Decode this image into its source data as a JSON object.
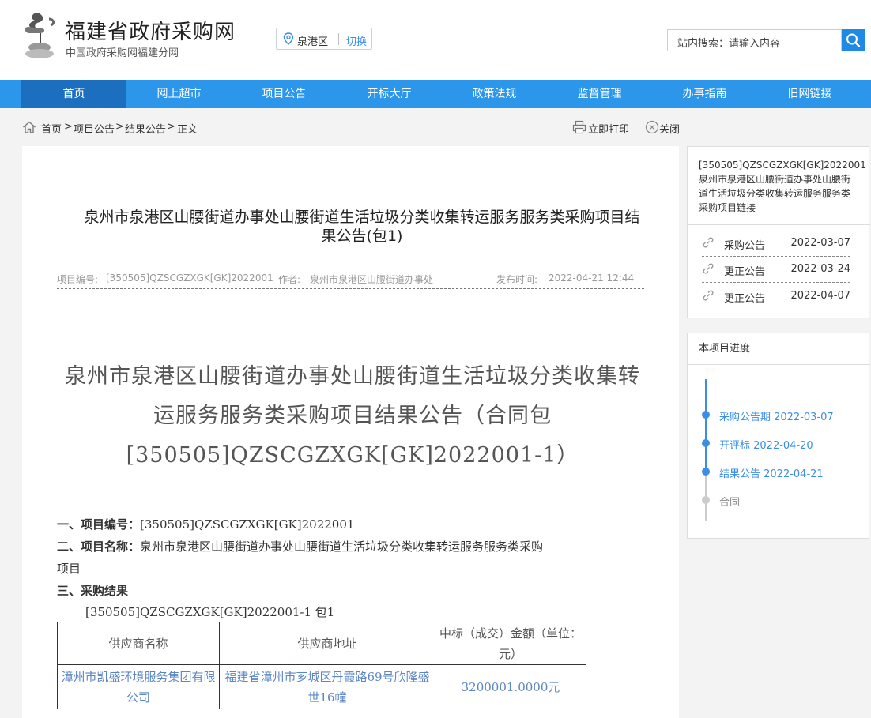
{
  "header": {
    "site_title": "福建省政府采购网",
    "site_subtitle": "中国政府采购网福建分网",
    "region": "泉港区",
    "region_switch": "切换",
    "search_placeholder": "站内搜索：请输入内容"
  },
  "nav": [
    "首页",
    "网上超市",
    "项目公告",
    "开标大厅",
    "政策法规",
    "监督管理",
    "办事指南",
    "旧网链接"
  ],
  "breadcrumb": {
    "items": [
      "首页",
      ">",
      "项目公告",
      ">",
      "结果公告",
      ">",
      "正文"
    ],
    "print": "立即打印",
    "close": "关闭"
  },
  "article": {
    "title": "泉州市泉港区山腰街道办事处山腰街道生活垃圾分类收集转运服务服务类采购项目结果公告(包1)",
    "meta_code_label": "项目编号:",
    "meta_code": "[350505]QZSCGZXGK[GK]2022001",
    "meta_author_label": "作者:",
    "meta_author": "泉州市泉港区山腰街道办事处",
    "meta_time_label": "发布时间:",
    "meta_time": "2022-04-21 12:44",
    "doc_title": "泉州市泉港区山腰街道办事处山腰街道生活垃圾分类收集转运服务服务类采购项目结果公告（合同包[350505]QZSCGZXGK[GK]2022001-1）",
    "sec1_label": "一、项目编号：",
    "sec1_value": "[350505]QZSCGZXGK[GK]2022001",
    "sec2_label": "二、项目名称：",
    "sec2_value": "泉州市泉港区山腰街道办事处山腰街道生活垃圾分类收集转运服务服务类采购",
    "sec2_value_cont": "项目",
    "sec3_label": "三、采购结果",
    "package_line": "[350505]QZSCGZXGK[GK]2022001-1 包1",
    "table_headers": [
      "供应商名称",
      "供应商地址",
      "中标（成交）金额（单位：元）"
    ],
    "table_row": {
      "name": "漳州市凯盛环境服务集团有限公司",
      "address": "福建省漳州市芗城区丹霞路69号欣隆盛世16幢",
      "amount": "3200001.0000元"
    }
  },
  "related": {
    "heading": "[350505]QZSCGZXGK[GK]2022001泉州市泉港区山腰街道办事处山腰街道生活垃圾分类收集转运服务服务类采购项目链接",
    "items": [
      {
        "name": "采购公告",
        "date": "2022-03-07"
      },
      {
        "name": "更正公告",
        "date": "2022-03-24"
      },
      {
        "name": "更正公告",
        "date": "2022-04-07"
      }
    ]
  },
  "progress": {
    "heading": "本项目进度",
    "steps": [
      {
        "label": "采购公告期 2022-03-07",
        "done": true
      },
      {
        "label": "开评标 2022-04-20",
        "done": true
      },
      {
        "label": "结果公告 2022-04-21",
        "done": true
      },
      {
        "label": "合同",
        "done": false
      }
    ]
  },
  "colors": {
    "nav_bg": "#2b96ea",
    "nav_active": "#1c6fbf",
    "accent": "#3a8ee6"
  }
}
